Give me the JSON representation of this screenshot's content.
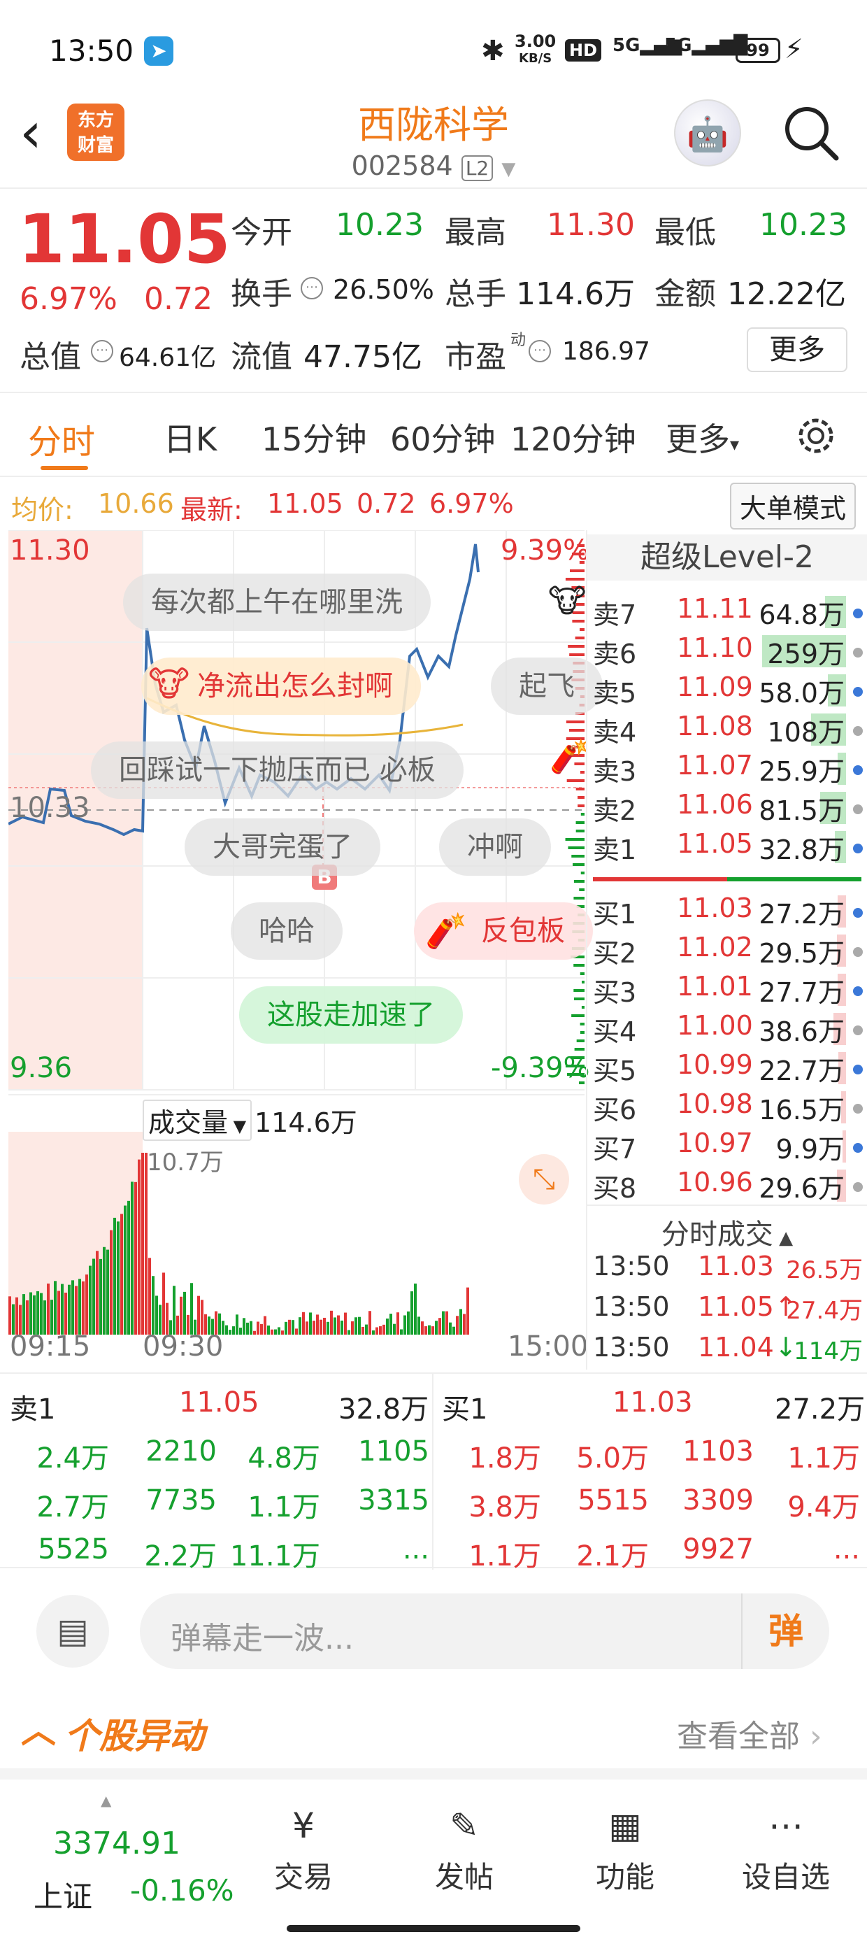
{
  "status_bar": {
    "time": "13:50",
    "speed_value": "3.00",
    "speed_unit": "KB/S",
    "hd_badge": "HD",
    "network": "5G",
    "network2": "5G",
    "battery": "99"
  },
  "header": {
    "title": "西陇科学",
    "code": "002584",
    "level_badge": "L2",
    "logo_line1": "东方",
    "logo_line2": "财富"
  },
  "quote": {
    "price": "11.05",
    "change_pct": "6.97%",
    "change": "0.72",
    "open_label": "今开",
    "open": "10.23",
    "high_label": "最高",
    "high": "11.30",
    "low_label": "最低",
    "low": "10.23",
    "turnover_label": "换手",
    "turnover": "26.50%",
    "volume_label": "总手",
    "volume": "114.6万",
    "amount_label": "金额",
    "amount": "12.22亿",
    "mktcap_label": "总值",
    "mktcap": "64.61亿",
    "float_label": "流值",
    "float": "47.75亿",
    "pe_label": "市盈",
    "pe_sup": "动",
    "pe": "186.97",
    "more_btn": "更多"
  },
  "tabs": [
    {
      "label": "分时"
    },
    {
      "label": "日K"
    },
    {
      "label": "15分钟"
    },
    {
      "label": "60分钟"
    },
    {
      "label": "120分钟"
    },
    {
      "label": "更多"
    }
  ],
  "info_line": {
    "avg_label": "均价:",
    "avg": "10.66",
    "latest_label": "最新:",
    "latest": "11.05",
    "chg": "0.72",
    "pct": "6.97%",
    "big_order_btn": "大单模式"
  },
  "chart": {
    "y_top": "11.30",
    "y_mid": "10.33",
    "y_bot": "9.36",
    "pct_top": "9.39%",
    "pct_bot": "-9.39%",
    "vol_selector": "成交量",
    "vol_total": "114.6万",
    "vol_max": "10.7万",
    "t_start": "09:15",
    "t_open": "09:30",
    "t_end": "15:00",
    "b_marker": "B"
  },
  "danmaku": [
    "每次都上午在哪里洗",
    "净流出怎么封啊",
    "起飞",
    "回踩试一下抛压而已 必板",
    "大哥完蛋了",
    "冲啊",
    "哈哈",
    "反包板",
    "这股走加速了"
  ],
  "orderbook": {
    "title": "超级Level-2",
    "asks": [
      {
        "label": "卖7",
        "price": "11.11",
        "vol": "64.8万",
        "bar": 0.25
      },
      {
        "label": "卖6",
        "price": "11.10",
        "vol": "259万",
        "bar": 1.0
      },
      {
        "label": "卖5",
        "price": "11.09",
        "vol": "58.0万",
        "bar": 0.22
      },
      {
        "label": "卖4",
        "price": "11.08",
        "vol": "108万",
        "bar": 0.42
      },
      {
        "label": "卖3",
        "price": "11.07",
        "vol": "25.9万",
        "bar": 0.1
      },
      {
        "label": "卖2",
        "price": "11.06",
        "vol": "81.5万",
        "bar": 0.31
      },
      {
        "label": "卖1",
        "price": "11.05",
        "vol": "32.8万",
        "bar": 0.13
      }
    ],
    "bids": [
      {
        "label": "买1",
        "price": "11.03",
        "vol": "27.2万",
        "bar": 0.1
      },
      {
        "label": "买2",
        "price": "11.02",
        "vol": "29.5万",
        "bar": 0.11
      },
      {
        "label": "买3",
        "price": "11.01",
        "vol": "27.7万",
        "bar": 0.1
      },
      {
        "label": "买4",
        "price": "11.00",
        "vol": "38.6万",
        "bar": 0.15
      },
      {
        "label": "买5",
        "price": "10.99",
        "vol": "22.7万",
        "bar": 0.09
      },
      {
        "label": "买6",
        "price": "10.98",
        "vol": "16.5万",
        "bar": 0.06
      },
      {
        "label": "买7",
        "price": "10.97",
        "vol": "9.9万",
        "bar": 0.04
      },
      {
        "label": "买8",
        "price": "10.96",
        "vol": "29.6万",
        "bar": 0.11
      }
    ],
    "ticks_title": "分时成交",
    "ticks": [
      {
        "time": "13:50",
        "price": "11.03",
        "vol": "26.5万",
        "arrow": ""
      },
      {
        "time": "13:50",
        "price": "11.05",
        "vol": "27.4万",
        "arrow": "↑"
      },
      {
        "time": "13:50",
        "price": "11.04",
        "vol": "114万",
        "arrow": "↓"
      }
    ]
  },
  "bid_table": {
    "sell_label": "卖1",
    "sell_price": "11.05",
    "sell_vol": "32.8万",
    "buy_label": "买1",
    "buy_price": "11.03",
    "buy_vol": "27.2万",
    "sell_rows": [
      [
        "2.4万",
        "2210",
        "4.8万",
        "1105"
      ],
      [
        "2.7万",
        "7735",
        "1.1万",
        "3315"
      ],
      [
        "5525",
        "2.2万",
        "11.1万",
        "..."
      ]
    ],
    "buy_rows": [
      [
        "1.8万",
        "5.0万",
        "1103",
        "1.1万"
      ],
      [
        "3.8万",
        "5515",
        "3309",
        "9.4万"
      ],
      [
        "1.1万",
        "2.1万",
        "9927",
        "..."
      ]
    ]
  },
  "comment": {
    "placeholder": "弹幕走一波...",
    "send": "弹"
  },
  "stock_move": {
    "title": "个股异动",
    "view_all": "查看全部"
  },
  "bottom_nav": {
    "index_value": "3374.91",
    "index_name": "上证",
    "index_change": "-0.16%",
    "trade": "交易",
    "post": "发帖",
    "func": "功能",
    "watch": "设自选"
  },
  "colors": {
    "up": "#e23636",
    "down": "#15a02e",
    "accent": "#f07a1a",
    "line": "#3a6fb0",
    "avg": "#e8b43a"
  }
}
